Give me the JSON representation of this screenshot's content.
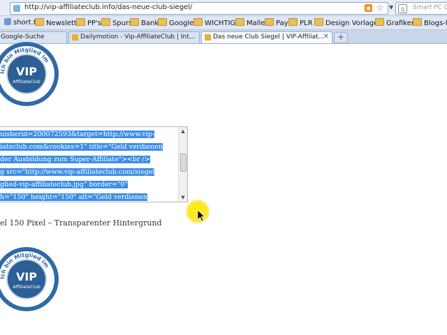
{
  "browser": {
    "url": "http://vip-affiliateclub.info/das-neue-club-siegel/",
    "search_placeholder": "Smart PC C"
  },
  "bookmarks": [
    {
      "label": "short.to",
      "type": "site"
    },
    {
      "label": "Newsletter",
      "type": "folder"
    },
    {
      "label": "PP's",
      "type": "folder"
    },
    {
      "label": "Spurs",
      "type": "folder"
    },
    {
      "label": "Bank",
      "type": "folder"
    },
    {
      "label": "Google",
      "type": "folder"
    },
    {
      "label": "WICHTIG!",
      "type": "folder"
    },
    {
      "label": "Malle",
      "type": "folder"
    },
    {
      "label": "Pay",
      "type": "folder"
    },
    {
      "label": "PLR",
      "type": "folder"
    },
    {
      "label": "Design Vorlagen",
      "type": "folder"
    },
    {
      "label": "Grafiken",
      "type": "folder"
    },
    {
      "label": "Blogs-les",
      "type": "folder"
    }
  ],
  "tabs": [
    {
      "label": "Google-Suche",
      "active": false
    },
    {
      "label": "Dailymotion - Vip-AffiliateClub | Int...",
      "active": false
    },
    {
      "label": "Das neue Club Siegel | VIP-Affiliat...",
      "active": true
    }
  ],
  "badge": {
    "ring_text": "Ich bin Mitglied im",
    "title": "VIP",
    "subtitle": "AffiliateClub",
    "color": "#2f6aa8"
  },
  "code_lines": [
    "uisherid=200072593&target=http://www.vip-",
    "iateclub.com&cookies=1\" title=\"Geld verdienen",
    "der Ausbildung zum Super-Affiliate\"><br />",
    "g src=\"http://www.vip-affiliateclub.com/siegel",
    "glied-vip-affiliateclub.jpg\" border=\"0\"",
    "h=\"150\" height=\"150\" alt=\"Geld verdienen"
  ],
  "caption": "el 150 Pixel – Transparenter Hintergrund",
  "colors": {
    "selection": "#3d8ee6",
    "cursor_highlight": "#ffe600"
  }
}
